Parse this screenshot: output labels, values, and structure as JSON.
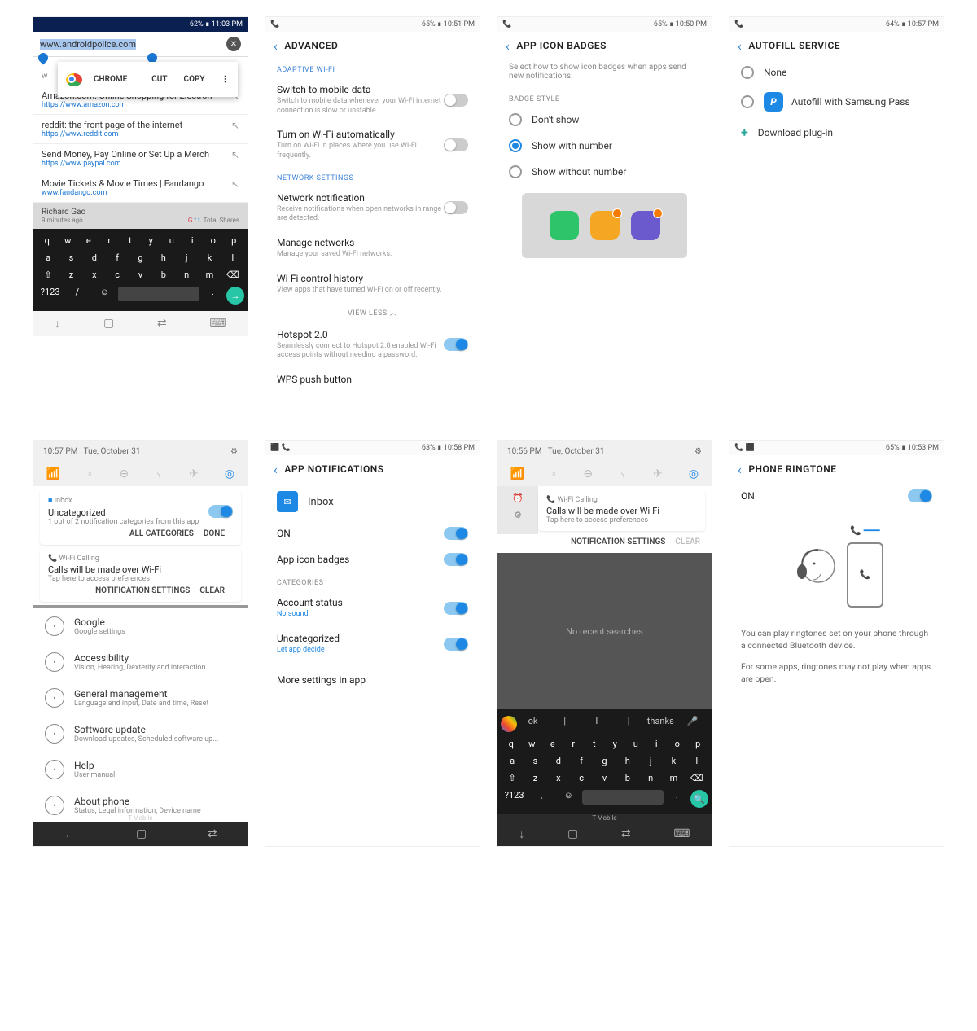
{
  "s1": {
    "status_right": "62% ∎ 11:03 PM",
    "url": "www.androidpolice.com",
    "ctx_chrome": "CHROME",
    "ctx_cut": "CUT",
    "ctx_copy": "COPY",
    "sugg": [
      {
        "title": "Amazon.com: Online Shopping for Electron",
        "url": "https://www.amazon.com"
      },
      {
        "title": "reddit: the front page of the internet",
        "url": "https://www.reddit.com"
      },
      {
        "title": "Send Money, Pay Online or Set Up a Merch",
        "url": "https://www.paypal.com"
      },
      {
        "title": "Movie Tickets & Movie Times | Fandango",
        "url": "www.fandango.com"
      }
    ],
    "article_author": "Richard Gao",
    "article_time": "9 minutes ago",
    "article_shares": "Total Shares",
    "kb_num": "?123"
  },
  "s2": {
    "status_right": "65% ∎ 10:51 PM",
    "title": "ADVANCED",
    "sec1": "ADAPTIVE WI-FI",
    "i1t": "Switch to mobile data",
    "i1d": "Switch to mobile data whenever your Wi-Fi internet connection is slow or unstable.",
    "i2t": "Turn on Wi-Fi automatically",
    "i2d": "Turn on Wi-Fi in places where you use Wi-Fi frequently.",
    "sec2": "NETWORK SETTINGS",
    "i3t": "Network notification",
    "i3d": "Receive notifications when open networks in range are detected.",
    "i4t": "Manage networks",
    "i4d": "Manage your saved Wi-Fi networks.",
    "i5t": "Wi-Fi control history",
    "i5d": "View apps that have turned Wi-Fi on or off recently.",
    "viewless": "VIEW LESS  ︿",
    "i6t": "Hotspot 2.0",
    "i6d": "Seamlessly connect to Hotspot 2.0 enabled Wi-Fi access points without needing a password.",
    "i7t": "WPS push button"
  },
  "s3": {
    "status_right": "65% ∎ 10:50 PM",
    "title": "APP ICON BADGES",
    "desc": "Select how to show icon badges when apps send new notifications.",
    "sec": "BADGE STYLE",
    "o1": "Don't show",
    "o2": "Show with number",
    "o3": "Show without number"
  },
  "s4": {
    "status_right": "64% ∎ 10:57 PM",
    "title": "AUTOFILL SERVICE",
    "o1": "None",
    "o2": "Autofill with Samsung Pass",
    "o3": "Download plug-in"
  },
  "s5": {
    "time": "10:57 PM",
    "date": "Tue, October 31",
    "notif1_app": "Inbox",
    "notif1_title": "Uncategorized",
    "notif1_desc": "1 out of 2 notification categories from this app",
    "notif1_a": "ALL CATEGORIES",
    "notif1_b": "DONE",
    "notif2_app": "Wi-Fi Calling",
    "notif2_title": "Calls will be made over Wi-Fi",
    "notif2_desc": "Tap here to access preferences",
    "notif2_a": "NOTIFICATION SETTINGS",
    "notif2_b": "CLEAR",
    "bg": [
      {
        "t": "Google",
        "d": "Google settings"
      },
      {
        "t": "Accessibility",
        "d": "Vision, Hearing, Dexterity and interaction"
      },
      {
        "t": "General management",
        "d": "Language and input, Date and time, Reset"
      },
      {
        "t": "Software update",
        "d": "Download updates, Scheduled software up..."
      },
      {
        "t": "Help",
        "d": "User manual"
      },
      {
        "t": "About phone",
        "d": "Status, Legal information, Device name"
      }
    ],
    "carrier": "T-Mobile"
  },
  "s6": {
    "status_right": "63% ∎ 10:58 PM",
    "title": "APP NOTIFICATIONS",
    "app": "Inbox",
    "i1": "ON",
    "i2": "App icon badges",
    "sec": "CATEGORIES",
    "i3": "Account status",
    "i3d": "No sound",
    "i4": "Uncategorized",
    "i4d": "Let app decide",
    "i5": "More settings in app"
  },
  "s7": {
    "time": "10:56 PM",
    "date": "Tue, October 31",
    "notif_app": "Wi-Fi Calling",
    "notif_title": "Calls will be made over Wi-Fi",
    "notif_desc": "Tap here to access preferences",
    "a1": "NOTIFICATION SETTINGS",
    "a2": "CLEAR",
    "no_recent": "No recent searches",
    "sg1": "ok",
    "sg2": "I",
    "sg3": "thanks",
    "carrier": "T-Mobile"
  },
  "s8": {
    "status_right": "65% ∎ 10:53 PM",
    "title": "PHONE RINGTONE",
    "on": "ON",
    "p1": "You can play ringtones set on your phone through a connected Bluetooth device.",
    "p2": "For some apps, ringtones may not play when apps are open."
  }
}
